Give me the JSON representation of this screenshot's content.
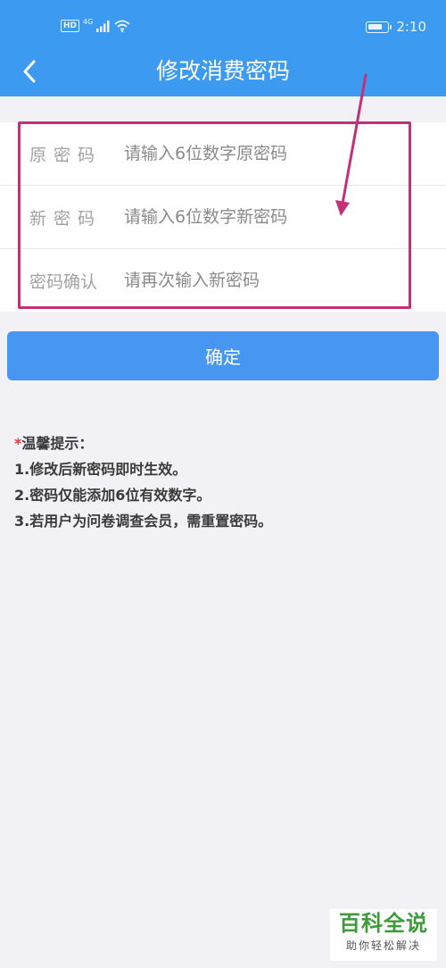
{
  "status_bar": {
    "hd": "HD",
    "network": "4G",
    "time": "2:10",
    "battery_level": 0.75,
    "icons": [
      "signal-icon",
      "wifi-icon",
      "battery-icon"
    ]
  },
  "header": {
    "title": "修改消费密码",
    "back_icon": "chevron-left-icon"
  },
  "form": {
    "rows": [
      {
        "label": "原密码",
        "placeholder": "请输入6位数字原密码"
      },
      {
        "label": "新密码",
        "placeholder": "请输入6位数字新密码"
      },
      {
        "label": "密码确认",
        "placeholder": "请再次输入新密码"
      }
    ]
  },
  "confirm_label": "确定",
  "tips": {
    "asterisk": "*",
    "title": "温馨提示：",
    "items": [
      "1.修改后新密码即时生效。",
      "2.密码仅能添加6位有效数字。",
      "3.若用户为问卷调查会员，需重置密码。"
    ]
  },
  "watermark": {
    "main": "百科全说",
    "sub": "助你轻松解决"
  },
  "colors": {
    "header": "#3d9af1",
    "button": "#4797f2",
    "annotation": "#c3307a",
    "background": "#f1f1f6",
    "watermark": "#3f9a3c"
  }
}
